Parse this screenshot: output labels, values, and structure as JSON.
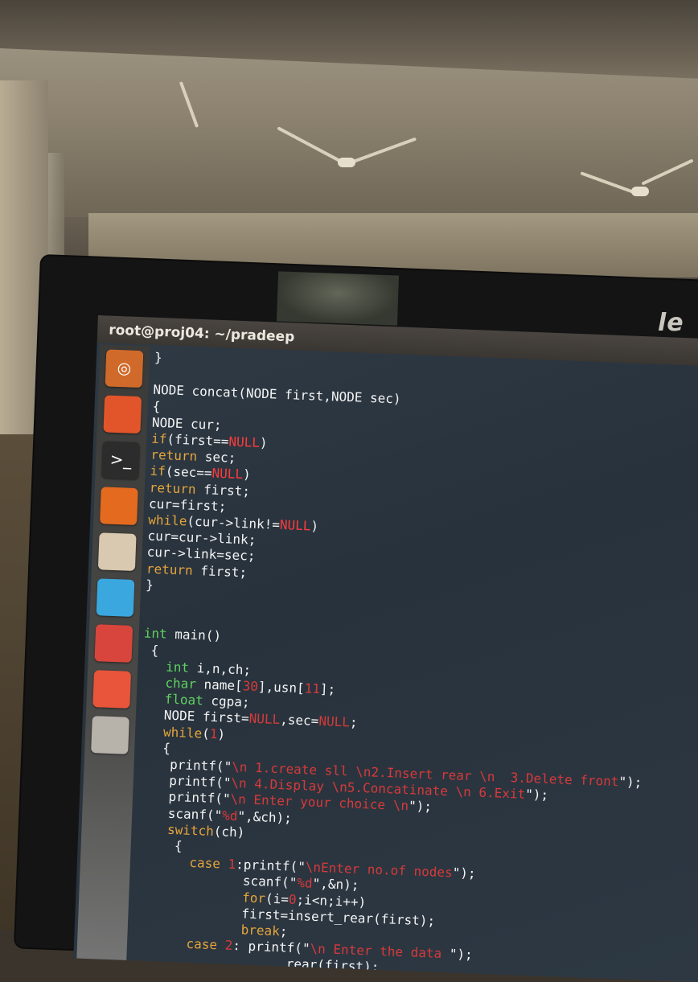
{
  "window": {
    "title": "root@proj04: ~/pradeep"
  },
  "monitor": {
    "brand": "le"
  },
  "launcher": {
    "icons": [
      {
        "name": "ubuntu-dash-icon",
        "color": "#d06a2a",
        "glyph": "◎"
      },
      {
        "name": "files-icon",
        "color": "#e2552a",
        "glyph": ""
      },
      {
        "name": "terminal-icon",
        "color": "#2c2c2c",
        "glyph": ">_"
      },
      {
        "name": "firefox-icon",
        "color": "#e36a1f",
        "glyph": ""
      },
      {
        "name": "libreoffice-impress-icon",
        "color": "#d9c9b0",
        "glyph": ""
      },
      {
        "name": "chrome-icon",
        "color": "#3aa7df",
        "glyph": ""
      },
      {
        "name": "system-settings-icon",
        "color": "#d8453c",
        "glyph": ""
      },
      {
        "name": "software-center-icon",
        "color": "#e8553a",
        "glyph": ""
      },
      {
        "name": "workspace-icon",
        "color": "#b7b3aa",
        "glyph": ""
      }
    ]
  },
  "code": {
    "lines": [
      [
        {
          "t": "}",
          "c": ""
        }
      ],
      [
        {
          "t": "",
          "c": ""
        }
      ],
      [
        {
          "t": "NODE concat(NODE first,NODE sec)",
          "c": ""
        }
      ],
      [
        {
          "t": "{",
          "c": ""
        }
      ],
      [
        {
          "t": "NODE cur;",
          "c": ""
        }
      ],
      [
        {
          "t": "if",
          "c": "kwo"
        },
        {
          "t": "(first==",
          "c": ""
        },
        {
          "t": "NULL",
          "c": "red"
        },
        {
          "t": ")",
          "c": ""
        }
      ],
      [
        {
          "t": "return",
          "c": "kwo"
        },
        {
          "t": " sec;",
          "c": ""
        }
      ],
      [
        {
          "t": "if",
          "c": "kwo"
        },
        {
          "t": "(sec==",
          "c": ""
        },
        {
          "t": "NULL",
          "c": "red"
        },
        {
          "t": ")",
          "c": ""
        }
      ],
      [
        {
          "t": "return",
          "c": "kwo"
        },
        {
          "t": " first;",
          "c": ""
        }
      ],
      [
        {
          "t": "cur=first;",
          "c": ""
        }
      ],
      [
        {
          "t": "while",
          "c": "kwo"
        },
        {
          "t": "(cur->link!=",
          "c": ""
        },
        {
          "t": "NULL",
          "c": "red"
        },
        {
          "t": ")",
          "c": ""
        }
      ],
      [
        {
          "t": "cur=cur->link;",
          "c": ""
        }
      ],
      [
        {
          "t": "cur->link=sec;",
          "c": ""
        }
      ],
      [
        {
          "t": "return",
          "c": "kwo"
        },
        {
          "t": " first;",
          "c": ""
        }
      ],
      [
        {
          "t": "}",
          "c": ""
        }
      ],
      [
        {
          "t": "",
          "c": ""
        }
      ],
      [
        {
          "t": "",
          "c": ""
        }
      ],
      [
        {
          "t": "int",
          "c": "kw"
        },
        {
          "t": " main()",
          "c": ""
        }
      ],
      [
        {
          "t": " {",
          "c": ""
        }
      ],
      [
        {
          "t": "   ",
          "c": ""
        },
        {
          "t": "int",
          "c": "kw"
        },
        {
          "t": " i,n,ch;",
          "c": ""
        }
      ],
      [
        {
          "t": "   ",
          "c": ""
        },
        {
          "t": "char",
          "c": "kw"
        },
        {
          "t": " name[",
          "c": ""
        },
        {
          "t": "30",
          "c": "sred"
        },
        {
          "t": "],usn[",
          "c": ""
        },
        {
          "t": "11",
          "c": "sred"
        },
        {
          "t": "];",
          "c": ""
        }
      ],
      [
        {
          "t": "   ",
          "c": ""
        },
        {
          "t": "float",
          "c": "kw"
        },
        {
          "t": " cgpa;",
          "c": ""
        }
      ],
      [
        {
          "t": "   NODE first=",
          "c": ""
        },
        {
          "t": "NULL",
          "c": "sred"
        },
        {
          "t": ",sec=",
          "c": ""
        },
        {
          "t": "NULL",
          "c": "sred"
        },
        {
          "t": ";",
          "c": ""
        }
      ],
      [
        {
          "t": "   ",
          "c": ""
        },
        {
          "t": "while",
          "c": "kwo"
        },
        {
          "t": "(",
          "c": ""
        },
        {
          "t": "1",
          "c": "sred"
        },
        {
          "t": ")",
          "c": ""
        }
      ],
      [
        {
          "t": "   {",
          "c": ""
        }
      ],
      [
        {
          "t": "    printf(\"",
          "c": ""
        },
        {
          "t": "\\n 1.create sll \\n2.Insert rear \\n  3.Delete front",
          "c": "sred"
        },
        {
          "t": "\");",
          "c": ""
        }
      ],
      [
        {
          "t": "    printf(\"",
          "c": ""
        },
        {
          "t": "\\n 4.Display \\n5.Concatinate \\n 6.Exit",
          "c": "sred"
        },
        {
          "t": "\");",
          "c": ""
        }
      ],
      [
        {
          "t": "    printf(\"",
          "c": ""
        },
        {
          "t": "\\n Enter your choice \\n",
          "c": "sred"
        },
        {
          "t": "\");",
          "c": ""
        }
      ],
      [
        {
          "t": "    scanf(\"",
          "c": ""
        },
        {
          "t": "%d",
          "c": "sred"
        },
        {
          "t": "\",&ch);",
          "c": ""
        }
      ],
      [
        {
          "t": "    ",
          "c": ""
        },
        {
          "t": "switch",
          "c": "kwo"
        },
        {
          "t": "(ch)",
          "c": ""
        }
      ],
      [
        {
          "t": "     {",
          "c": ""
        }
      ],
      [
        {
          "t": "       ",
          "c": ""
        },
        {
          "t": "case",
          "c": "kwo"
        },
        {
          "t": " ",
          "c": ""
        },
        {
          "t": "1",
          "c": "sred"
        },
        {
          "t": ":printf(\"",
          "c": ""
        },
        {
          "t": "\\nEnter no.of nodes",
          "c": "sred"
        },
        {
          "t": "\");",
          "c": ""
        }
      ],
      [
        {
          "t": "              scanf(\"",
          "c": ""
        },
        {
          "t": "%d",
          "c": "sred"
        },
        {
          "t": "\",&n);",
          "c": ""
        }
      ],
      [
        {
          "t": "              ",
          "c": ""
        },
        {
          "t": "for",
          "c": "kwo"
        },
        {
          "t": "(i=",
          "c": ""
        },
        {
          "t": "0",
          "c": "sred"
        },
        {
          "t": ";i<n;i++)",
          "c": ""
        }
      ],
      [
        {
          "t": "              first=insert_rear(first);",
          "c": ""
        }
      ],
      [
        {
          "t": "              ",
          "c": ""
        },
        {
          "t": "break",
          "c": "kwo"
        },
        {
          "t": ";",
          "c": ""
        }
      ],
      [
        {
          "t": "       ",
          "c": ""
        },
        {
          "t": "case",
          "c": "kwo"
        },
        {
          "t": " ",
          "c": ""
        },
        {
          "t": "2",
          "c": "sred"
        },
        {
          "t": ": printf(\"",
          "c": ""
        },
        {
          "t": "\\n Enter the data ",
          "c": "sred"
        },
        {
          "t": "\");",
          "c": ""
        }
      ],
      [
        {
          "t": "                    rear(first);",
          "c": ""
        }
      ]
    ]
  }
}
